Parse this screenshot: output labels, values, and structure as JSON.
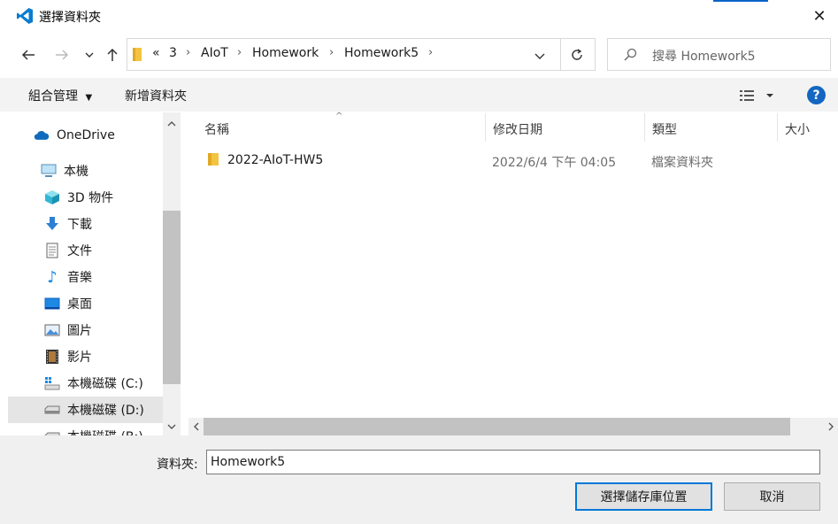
{
  "window": {
    "title": "選擇資料夾",
    "close_symbol": "✕",
    "app_icon": "vscode-icon"
  },
  "nav": {
    "back_icon": "arrow-left-icon",
    "forward_icon": "arrow-right-icon",
    "recent_icon": "chevron-down-icon",
    "up_icon": "arrow-up-icon",
    "overflow_label": "«",
    "breadcrumbs": [
      "3",
      "AIoT",
      "Homework",
      "Homework5"
    ],
    "refresh_icon": "refresh-icon",
    "search_placeholder": "搜尋 Homework5"
  },
  "toolbar": {
    "organize_label": "組合管理",
    "new_folder_label": "新增資料夾",
    "view_icon": "view-options-icon",
    "help_label": "?"
  },
  "sidebar": {
    "items": [
      {
        "label": "OneDrive",
        "icon": "cloud-icon"
      },
      {
        "label": "本機",
        "icon": "computer-icon"
      },
      {
        "label": "3D 物件",
        "icon": "cube-3d-icon"
      },
      {
        "label": "下載",
        "icon": "download-icon"
      },
      {
        "label": "文件",
        "icon": "document-icon"
      },
      {
        "label": "音樂",
        "icon": "music-icon"
      },
      {
        "label": "桌面",
        "icon": "desktop-icon"
      },
      {
        "label": "圖片",
        "icon": "pictures-icon"
      },
      {
        "label": "影片",
        "icon": "video-icon"
      },
      {
        "label": "本機磁碟 (C:)",
        "icon": "drive-c-icon"
      },
      {
        "label": "本機磁碟 (D:)",
        "icon": "drive-icon"
      },
      {
        "label": "本機磁碟 (B:)",
        "icon": "drive-icon"
      }
    ],
    "selected_index": 10
  },
  "filelist": {
    "columns": [
      "名稱",
      "修改日期",
      "類型",
      "大小"
    ],
    "rows": [
      {
        "name": "2022-AIoT-HW5",
        "modified": "2022/6/4 下午 04:05",
        "type": "檔案資料夾",
        "size": ""
      }
    ]
  },
  "footer": {
    "folder_label": "資料夾:",
    "folder_value": "Homework5",
    "ok_label": "選擇儲存庫位置",
    "cancel_label": "取消"
  },
  "colors": {
    "accent": "#0078d7",
    "selected_bg": "#e5e5e5",
    "folder": "#f3c441",
    "help": "#1466c0"
  }
}
